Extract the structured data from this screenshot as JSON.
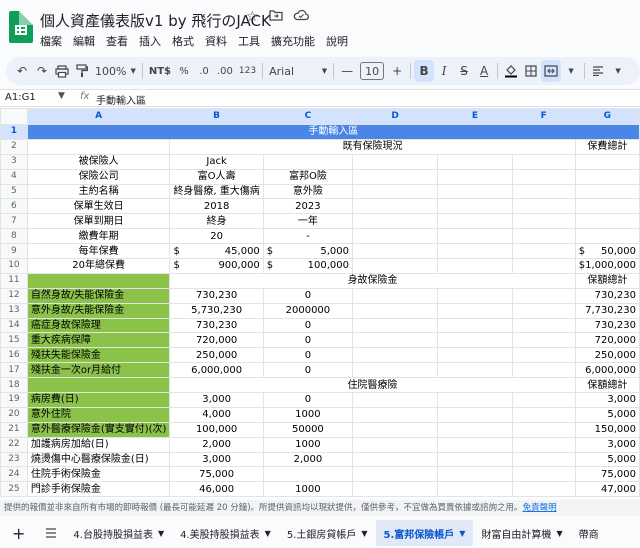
{
  "app": {
    "title": "個人資產儀表版v1 by 飛行のJACK",
    "menu": [
      "檔案",
      "編輯",
      "查看",
      "插入",
      "格式",
      "資料",
      "工具",
      "擴充功能",
      "說明"
    ]
  },
  "toolbar": {
    "zoom": "100%",
    "currency": "NT$",
    "percent": "%",
    "dec_decrease": ".0",
    "dec_increase": ".00",
    "number_format": "123",
    "font": "Arial",
    "font_size": "10",
    "bold": "B",
    "italic": "I",
    "text_color": "A"
  },
  "formula_bar": {
    "cell_ref": "A1:G1",
    "fx": "fx",
    "content": "手動輸入區"
  },
  "columns": [
    "A",
    "B",
    "C",
    "D",
    "E",
    "F",
    "G"
  ],
  "rows": [
    {
      "n": "1",
      "cells": [
        "手動輸入區"
      ]
    },
    {
      "n": "2",
      "cells": [
        "",
        "既有保險現況",
        "",
        "",
        "",
        "保費總計"
      ]
    },
    {
      "n": "3",
      "cells": [
        "被保險人",
        "Jack",
        "",
        "",
        "",
        "",
        ""
      ]
    },
    {
      "n": "4",
      "cells": [
        "保險公司",
        "富O人壽",
        "富邦O險",
        "",
        "",
        "",
        ""
      ]
    },
    {
      "n": "5",
      "cells": [
        "主約名稱",
        "終身醫療, 重大傷病",
        "意外險",
        "",
        "",
        "",
        ""
      ]
    },
    {
      "n": "6",
      "cells": [
        "保單生效日",
        "2018",
        "2023",
        "",
        "",
        "",
        ""
      ]
    },
    {
      "n": "7",
      "cells": [
        "保單到期日",
        "終身",
        "一年",
        "",
        "",
        "",
        ""
      ]
    },
    {
      "n": "8",
      "cells": [
        "繳費年期",
        "20",
        "-",
        "",
        "",
        "",
        ""
      ]
    },
    {
      "n": "9",
      "cells": [
        "每年保費",
        "$|45,000",
        "$|5,000",
        "",
        "",
        "",
        "$|50,000"
      ]
    },
    {
      "n": "10",
      "cells": [
        "20年總保費",
        "$|900,000",
        "$|100,000",
        "",
        "",
        "",
        "$|1,000,000"
      ]
    },
    {
      "n": "11",
      "cells": [
        "",
        "身故保險金",
        "",
        "",
        "",
        "保額總計"
      ]
    },
    {
      "n": "12",
      "cells": [
        "自然身故/失能保險金",
        "730,230",
        "0",
        "",
        "",
        "",
        "730,230"
      ]
    },
    {
      "n": "13",
      "cells": [
        "意外身故/失能保險金",
        "5,730,230",
        "2000000",
        "",
        "",
        "",
        "7,730,230"
      ]
    },
    {
      "n": "14",
      "cells": [
        "癌症身故保險理",
        "730,230",
        "0",
        "",
        "",
        "",
        "730,230"
      ]
    },
    {
      "n": "15",
      "cells": [
        "重大疾病保障",
        "720,000",
        "0",
        "",
        "",
        "",
        "720,000"
      ]
    },
    {
      "n": "16",
      "cells": [
        "殘扶失能保險金",
        "250,000",
        "0",
        "",
        "",
        "",
        "250,000"
      ]
    },
    {
      "n": "17",
      "cells": [
        "殘扶金一次or月給付",
        "6,000,000",
        "0",
        "",
        "",
        "",
        "6,000,000"
      ]
    },
    {
      "n": "18",
      "cells": [
        "",
        "住院醫療險",
        "",
        "",
        "",
        "保額總計"
      ]
    },
    {
      "n": "19",
      "cells": [
        "病房費(日)",
        "3,000",
        "0",
        "",
        "",
        "",
        "3,000"
      ]
    },
    {
      "n": "20",
      "cells": [
        "意外住院",
        "4,000",
        "1000",
        "",
        "",
        "",
        "5,000"
      ]
    },
    {
      "n": "21",
      "cells": [
        "意外醫療保險金(實支實付)(次)",
        "100,000",
        "50000",
        "",
        "",
        "",
        "150,000"
      ]
    },
    {
      "n": "22",
      "cells": [
        "加護病房加給(日)",
        "2,000",
        "1000",
        "",
        "",
        "",
        "3,000"
      ]
    },
    {
      "n": "23",
      "cells": [
        "燒燙傷中心醫療保險金(日)",
        "3,000",
        "2,000",
        "",
        "",
        "",
        "5,000"
      ]
    },
    {
      "n": "24",
      "cells": [
        "住院手術保險金",
        "75,000",
        "",
        "",
        "",
        "",
        "75,000"
      ]
    },
    {
      "n": "25",
      "cells": [
        "門診手術保險金",
        "46,000",
        "1000",
        "",
        "",
        "",
        "47,000"
      ]
    }
  ],
  "disclaimer": {
    "text": "提供的報價並非來自所有市場的即時報價 (最長可能延遲 20 分鐘)。所提供資訊均以現狀提供，僅供參考，不宜做為買賣依據或諮詢之用。",
    "link": "免責聲明"
  },
  "sheet_tabs": [
    {
      "label": "4.台股持股損益表",
      "active": false
    },
    {
      "label": "4.美股持股損益表",
      "active": false
    },
    {
      "label": "5.土銀房貸帳戶",
      "active": false
    },
    {
      "label": "5.富邦保險帳戶",
      "active": true
    },
    {
      "label": "財富自由計算機",
      "active": false
    },
    {
      "label": "帶商",
      "active": false
    }
  ],
  "colors": {
    "header_blue": "#4a86e8",
    "label_green": "#8bc34a",
    "active_tab": "#0b57d0"
  }
}
